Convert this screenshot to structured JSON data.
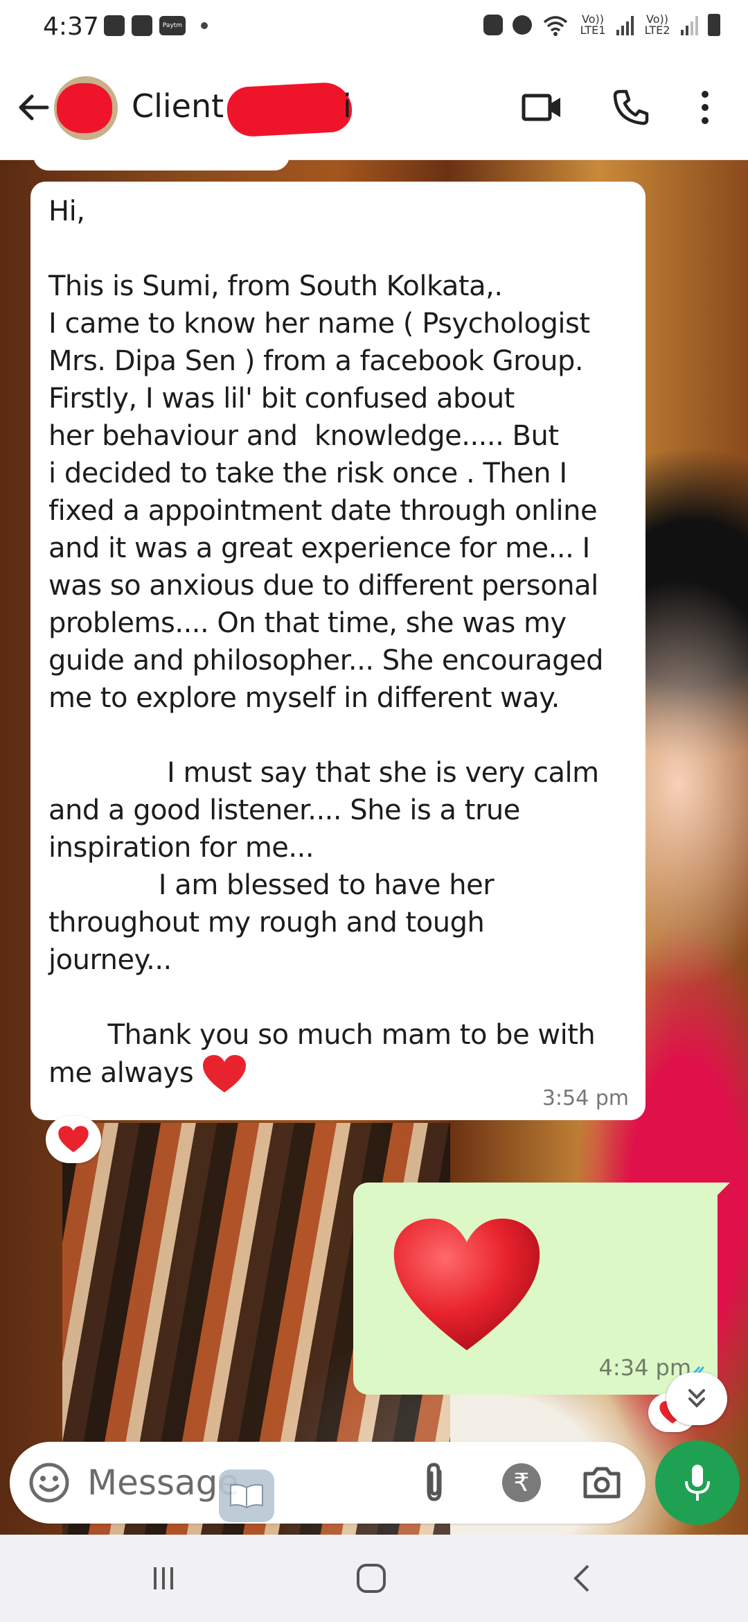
{
  "status_bar": {
    "time": "4:37",
    "sim1": "Vo)) LTE1",
    "sim2": "Vo)) LTE2",
    "app_badge": "Paytm"
  },
  "header": {
    "contact_name_visible": "Client",
    "contact_name_tail": "i"
  },
  "messages": [
    {
      "direction": "incoming",
      "text": "Hi,\n\nThis is Sumi, from South Kolkata,.\nI came to know her name ( Psychologist\nMrs. Dipa Sen ) from a facebook Group.\nFirstly, I was lil' bit confused about\nher behaviour and  knowledge..... But\ni decided to take the risk once . Then I\nfixed a appointment date through online\nand it was a great experience for me... I\nwas so anxious due to different personal\nproblems.... On that time, she was my\nguide and philosopher... She encouraged\nme to explore myself in different way.\n\n              I must say that she is very calm\nand a good listener.... She is a true\ninspiration for me...\n             I am blessed to have her\nthroughout my rough and tough\njourney...\n\n       Thank you so much mam to be with\nme always",
      "time": "3:54 pm",
      "reaction": "red-heart"
    },
    {
      "direction": "outgoing",
      "content": "red-heart-emoji",
      "time": "4:34 pm",
      "status": "read"
    }
  ],
  "composer": {
    "placeholder": "Message"
  },
  "colors": {
    "outgoing_bubble": "#dcf8c6",
    "mic_button": "#1ea152",
    "heart": "#e8232d",
    "redaction": "#f0142b"
  }
}
